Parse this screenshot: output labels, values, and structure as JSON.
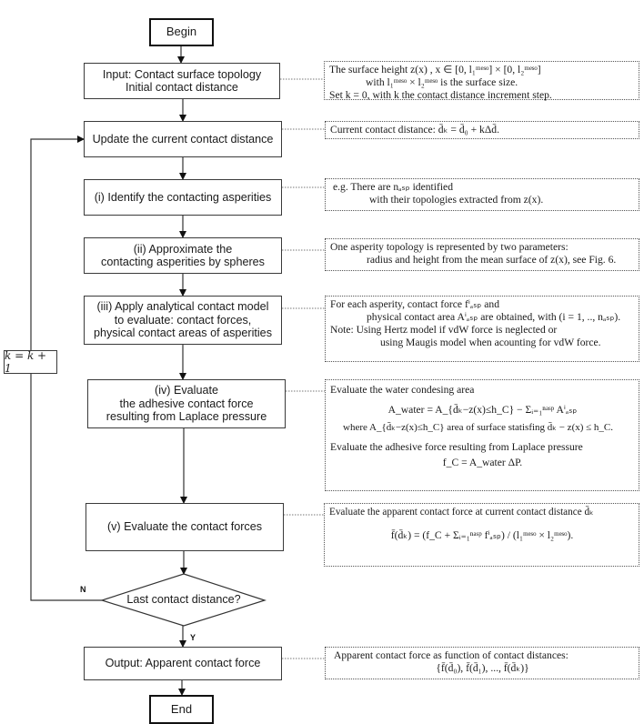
{
  "flowchart": {
    "begin": "Begin",
    "end": "End",
    "steps": [
      {
        "id": "input",
        "lines": [
          "Input: Contact surface topology",
          "Initial contact distance"
        ]
      },
      {
        "id": "update",
        "lines": [
          "Update the current contact distance"
        ]
      },
      {
        "id": "identify",
        "lines": [
          "(i) Identify the contacting asperities"
        ]
      },
      {
        "id": "approximate",
        "lines": [
          "(ii) Approximate the",
          "contacting asperities by spheres"
        ]
      },
      {
        "id": "apply",
        "lines": [
          "(iii) Apply analytical contact model",
          "to evaluate: contact forces,",
          "physical contact areas of asperities"
        ]
      },
      {
        "id": "adhesive",
        "lines": [
          "(iv) Evaluate",
          "the adhesive contact force",
          "resulting from Laplace pressure"
        ]
      },
      {
        "id": "forces",
        "lines": [
          "(v) Evaluate the contact forces"
        ]
      },
      {
        "id": "output",
        "lines": [
          "Output: Apparent contact force"
        ]
      }
    ],
    "decision": "Last contact distance?",
    "decision_no": "N",
    "decision_yes": "Y",
    "increment": "k = k + 1"
  },
  "notes": {
    "input": [
      "The surface height z(x) , x ∈ [0, l₁ᵐᵉˢᵒ] × [0, l₂ᵐᵉˢᵒ]",
      "with l₁ᵐᵉˢᵒ × l₂ᵐᵉˢᵒ is the surface size.",
      "Set k = 0,  with k the contact distance increment step."
    ],
    "update": [
      "Current contact distance: d̄ₖ = d̄₀ + kΔd̄."
    ],
    "identify": [
      "e.g.  There are nₐₛₚ identified",
      "with their topologies extracted from z(x)."
    ],
    "approximate": [
      "One asperity topology is represented by two parameters:",
      "radius and height from the mean surface of z(x),  see Fig. 6."
    ],
    "apply": [
      "For each asperity, contact force fⁱₐₛₚ and",
      "physical contact area Aⁱₐₛₚ are obtained, with (i = 1, .., nₐₛₚ).",
      "Note:  Using Hertz model if vdW force is neglected or",
      "using Maugis model when acounting for vdW force."
    ],
    "adhesive": [
      "Evaluate the water condesing area",
      "A_water = A_{d̄ₖ−z(x)≤h_C} − Σᵢ₌₁ⁿᵃˢᵖ Aⁱₐₛₚ",
      "where A_{d̄ₖ−z(x)≤h_C} area of surface statisfing d̄ₖ − z(x) ≤ h_C.",
      "Evaluate the adhesive force resulting from Laplace pressure",
      "f_C = A_water ΔP."
    ],
    "forces": [
      "Evaluate the apparent contact force at current contact distance d̄ₖ",
      "f̄(d̄ₖ) = (f_C + Σᵢ₌₁ⁿᵃˢᵖ fⁱₐₛₚ) / (l₁ᵐᵉˢᵒ × l₂ᵐᵉˢᵒ)."
    ],
    "output": [
      "Apparent contact force as function of contact distances:",
      "{f̄(d̄₀),  f̄(d̄₁), ..., f̄(d̄ₖ)}"
    ]
  }
}
